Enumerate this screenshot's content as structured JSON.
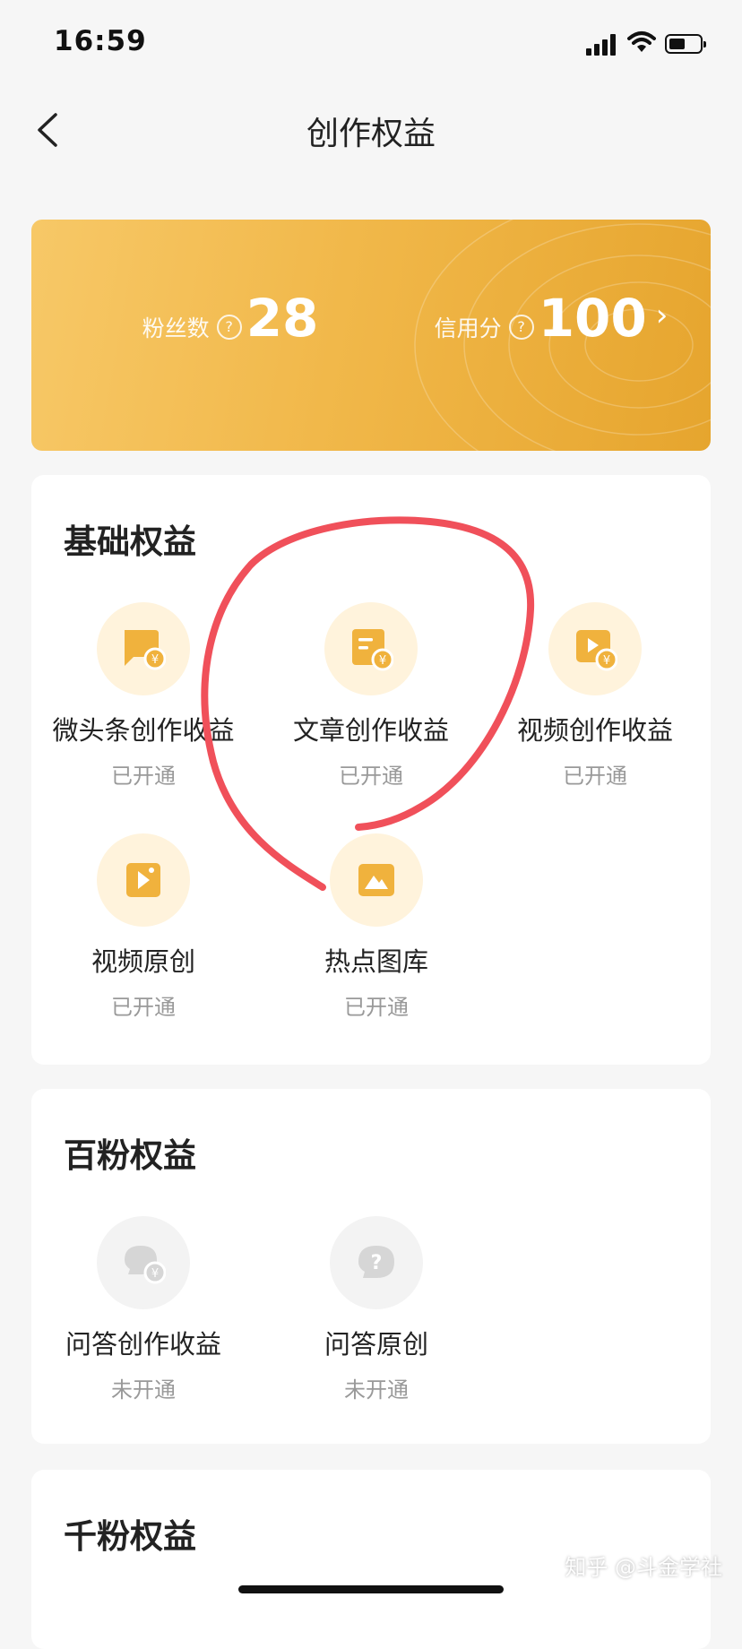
{
  "status_bar": {
    "time": "16:59"
  },
  "nav": {
    "title": "创作权益"
  },
  "stats": {
    "fans_label": "粉丝数",
    "fans_value": "28",
    "credit_label": "信用分",
    "credit_value": "100",
    "help_glyph": "?",
    "chevron_glyph": "›"
  },
  "sections": [
    {
      "title": "基础权益",
      "items": [
        {
          "label": "微头条创作收益",
          "status": "已开通",
          "icon": "chat-yuan-icon"
        },
        {
          "label": "文章创作收益",
          "status": "已开通",
          "icon": "article-yuan-icon"
        },
        {
          "label": "视频创作收益",
          "status": "已开通",
          "icon": "video-yuan-icon"
        },
        {
          "label": "视频原创",
          "status": "已开通",
          "icon": "video-original-icon"
        },
        {
          "label": "热点图库",
          "status": "已开通",
          "icon": "image-gallery-icon"
        }
      ]
    },
    {
      "title": "百粉权益",
      "items": [
        {
          "label": "问答创作收益",
          "status": "未开通",
          "icon": "qa-yuan-icon"
        },
        {
          "label": "问答原创",
          "status": "未开通",
          "icon": "qa-original-icon"
        }
      ]
    },
    {
      "title": "千粉权益",
      "items": []
    }
  ],
  "watermark": "知乎 @斗金学社",
  "colors": {
    "banner_start": "#f7c867",
    "banner_end": "#e6a52e",
    "icon_gold": "#f0b23d",
    "icon_grey": "#d6d6d6",
    "annotation_red": "#f0505a"
  }
}
